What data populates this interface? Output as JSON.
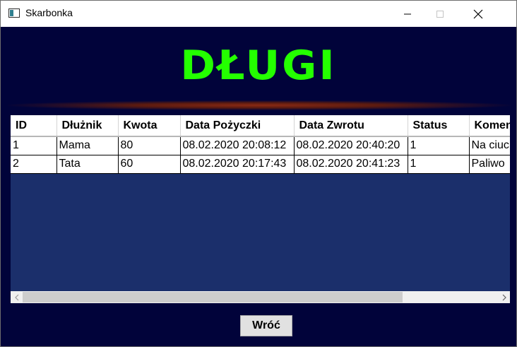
{
  "window": {
    "title": "Skarbonka",
    "icon": "window-app-icon",
    "controls": [
      "minimize-icon",
      "maximize-icon",
      "close-icon"
    ]
  },
  "page": {
    "heading": "DŁUGI",
    "heading_color": "#24ff00",
    "background_color": "#01033a",
    "grid_background_color": "#1b2f6b"
  },
  "table": {
    "columns": [
      "ID",
      "Dłużnik",
      "Kwota",
      "Data Pożyczki",
      "Data Zwrotu",
      "Status",
      "Komentarz"
    ],
    "rows": [
      [
        "1",
        "Mama",
        "80",
        "08.02.2020 20:08:12",
        "08.02.2020 20:40:20",
        "1",
        "Na ciuchy"
      ],
      [
        "2",
        "Tata",
        "60",
        "08.02.2020 20:17:43",
        "08.02.2020 20:41:23",
        "1",
        "Paliwo"
      ]
    ]
  },
  "scrollbar": {
    "horizontal_position": 0,
    "visible_fraction": 0.8
  },
  "buttons": {
    "back_label": "Wróć"
  }
}
